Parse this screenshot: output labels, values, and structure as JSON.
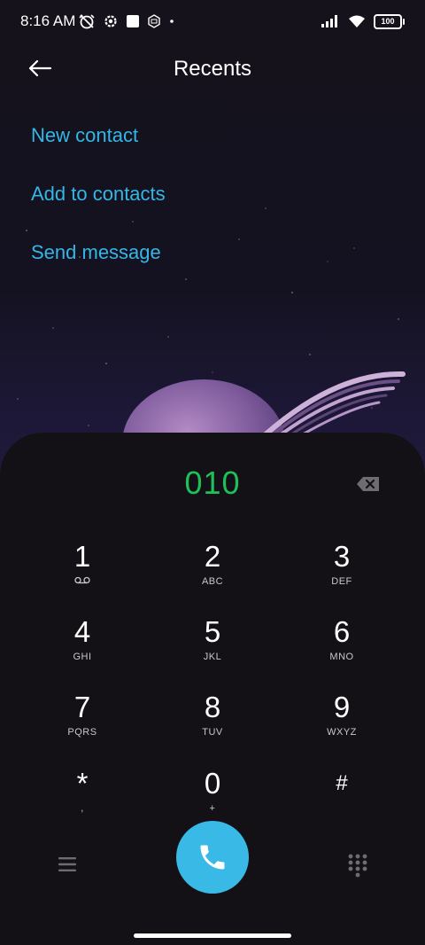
{
  "status_bar": {
    "time": "8:16 AM",
    "icons_left": [
      "alarm-off-icon",
      "settings-gear-icon",
      "square-notification-icon",
      "mi-icon",
      "dot-icon"
    ],
    "icons_right": [
      "signal-icon",
      "wifi-icon",
      "battery-icon"
    ],
    "battery_level": "100"
  },
  "header": {
    "title": "Recents",
    "back_icon": "arrow-left-icon"
  },
  "actions": {
    "new_contact": "New contact",
    "add_to_contacts": "Add to contacts",
    "send_message": "Send message"
  },
  "dialer": {
    "number": "010",
    "keys": [
      {
        "digit": "1",
        "letters": "voicemail-icon"
      },
      {
        "digit": "2",
        "letters": "ABC"
      },
      {
        "digit": "3",
        "letters": "DEF"
      },
      {
        "digit": "4",
        "letters": "GHI"
      },
      {
        "digit": "5",
        "letters": "JKL"
      },
      {
        "digit": "6",
        "letters": "MNO"
      },
      {
        "digit": "7",
        "letters": "PQRS"
      },
      {
        "digit": "8",
        "letters": "TUV"
      },
      {
        "digit": "9",
        "letters": "WXYZ"
      },
      {
        "digit": "*",
        "letters": ","
      },
      {
        "digit": "0",
        "letters": "+"
      },
      {
        "digit": "#",
        "letters": ""
      }
    ]
  },
  "colors": {
    "accent": "#35b6e6",
    "number_green": "#1fc05a",
    "call_button": "#39b9e6",
    "dialpad_bg": "#141116"
  }
}
